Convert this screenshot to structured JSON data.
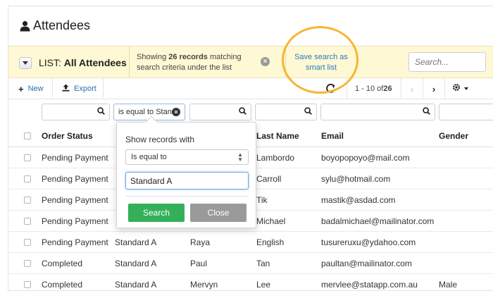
{
  "page": {
    "title": "Attendees",
    "title_icon": "user-icon"
  },
  "list_bar": {
    "prefix": "LIST:",
    "name": "All Attendees",
    "match_before": "Showing ",
    "match_count": "26 records",
    "match_after": " matching search criteria under the list",
    "save_line1": "Save search as",
    "save_line2": "smart list",
    "search_placeholder": "Search...",
    "highlight_color": "#f5b731"
  },
  "toolbar": {
    "new_label": "New",
    "export_label": "Export",
    "range": "1 - 10 of ",
    "total": "26"
  },
  "filters": {
    "status_filter_value": "is equal to Standard A"
  },
  "columns": [
    "Order Status",
    "",
    "",
    "Last Name",
    "Email",
    "Gender"
  ],
  "rows": [
    {
      "status": "Pending Payment",
      "ticket": "",
      "first": "",
      "last": "Lambordo",
      "email": "boyopopoyo@mail.com",
      "gender": ""
    },
    {
      "status": "Pending Payment",
      "ticket": "",
      "first": "",
      "last": "Carroll",
      "email": "sylu@hotmail.com",
      "gender": ""
    },
    {
      "status": "Pending Payment",
      "ticket": "",
      "first": "",
      "last": "Tik",
      "email": "mastik@asdad.com",
      "gender": ""
    },
    {
      "status": "Pending Payment",
      "ticket": "",
      "first": "",
      "last": "Michael",
      "email": "badalmichael@mailinator.com",
      "gender": ""
    },
    {
      "status": "Pending Payment",
      "ticket": "Standard A",
      "first": "Raya",
      "last": "English",
      "email": "tusureruxu@ydahoo.com",
      "gender": ""
    },
    {
      "status": "Completed",
      "ticket": "Standard A",
      "first": "Paul",
      "last": "Tan",
      "email": "paultan@mailinator.com",
      "gender": ""
    },
    {
      "status": "Completed",
      "ticket": "Standard A",
      "first": "Mervyn",
      "last": "Lee",
      "email": "mervlee@statapp.com.au",
      "gender": "Male"
    }
  ],
  "popup": {
    "label": "Show records with",
    "operator": "Is equal to",
    "value": "Standard A",
    "search_label": "Search",
    "close_label": "Close",
    "search_color": "#34b05a",
    "close_color": "#9a9a9a"
  }
}
